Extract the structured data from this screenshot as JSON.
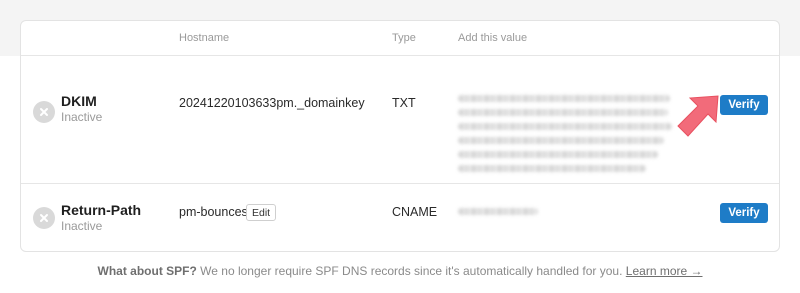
{
  "table": {
    "headers": {
      "hostname": "Hostname",
      "type": "Type",
      "value": "Add this value"
    }
  },
  "records": [
    {
      "name": "DKIM",
      "status": "Inactive",
      "hostname": "20241220103633pm._domainkey",
      "type": "TXT",
      "verify_label": "Verify"
    },
    {
      "name": "Return-Path",
      "status": "Inactive",
      "hostname": "pm-bounces",
      "edit_label": "Edit",
      "type": "CNAME",
      "verify_label": "Verify"
    }
  ],
  "footer": {
    "question": "What about SPF?",
    "text": "We no longer require SPF DNS records since it's automatically handled for you.",
    "link": "Learn more →"
  },
  "colors": {
    "accent": "#1e7cc7",
    "annotation_arrow": "#f26b7a",
    "inactive_icon": "#d9d9d9"
  },
  "icons": {
    "status": "close-circle-icon",
    "annotation": "pointer-arrow-icon"
  }
}
